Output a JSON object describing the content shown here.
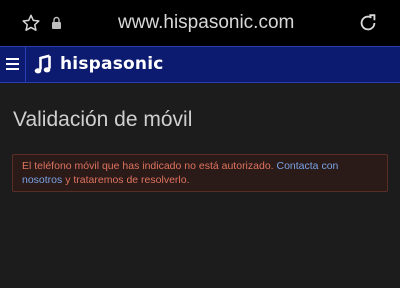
{
  "browser": {
    "url": "www.hispasonic.com",
    "icons": [
      "star-icon",
      "lock-icon",
      "reload-icon"
    ]
  },
  "header": {
    "logo_text": "hispasonic",
    "icons": [
      "menu-icon",
      "logo-icon"
    ],
    "background_color": "#0c1a70"
  },
  "main": {
    "title": "Validación de móvil",
    "alert": {
      "text_before": "El teléfono móvil que has indicado no está autorizado. ",
      "link_text": "Contacta con nosotros",
      "text_after": " y trataremos de resolverlo.",
      "text_color": "#e0735f",
      "link_color": "#7aa4e6"
    }
  }
}
